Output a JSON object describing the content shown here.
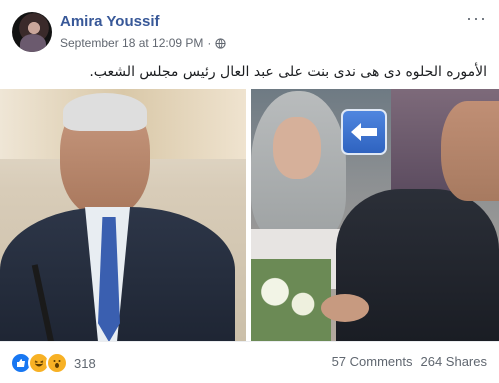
{
  "post": {
    "author": "Amira Youssif",
    "timestamp": "September 18 at 12:09 PM",
    "separator": "·",
    "privacy_icon": "globe-icon",
    "menu_icon": "more-icon",
    "menu_glyph": "···",
    "text": "الأموره الحلوه دى هى ندى بنت على عبد العال رئيس مجلس الشعب."
  },
  "photos": {
    "arrow_icon": "left-arrow-icon"
  },
  "footer": {
    "reactions": [
      "like-icon",
      "haha-icon",
      "wow-icon"
    ],
    "reaction_count": "318",
    "comments": "57 Comments",
    "shares": "264 Shares"
  },
  "colors": {
    "author_link": "#385898",
    "meta_text": "#616770",
    "like_blue": "#1877f2",
    "emoji_yellow": "#f7b125"
  }
}
